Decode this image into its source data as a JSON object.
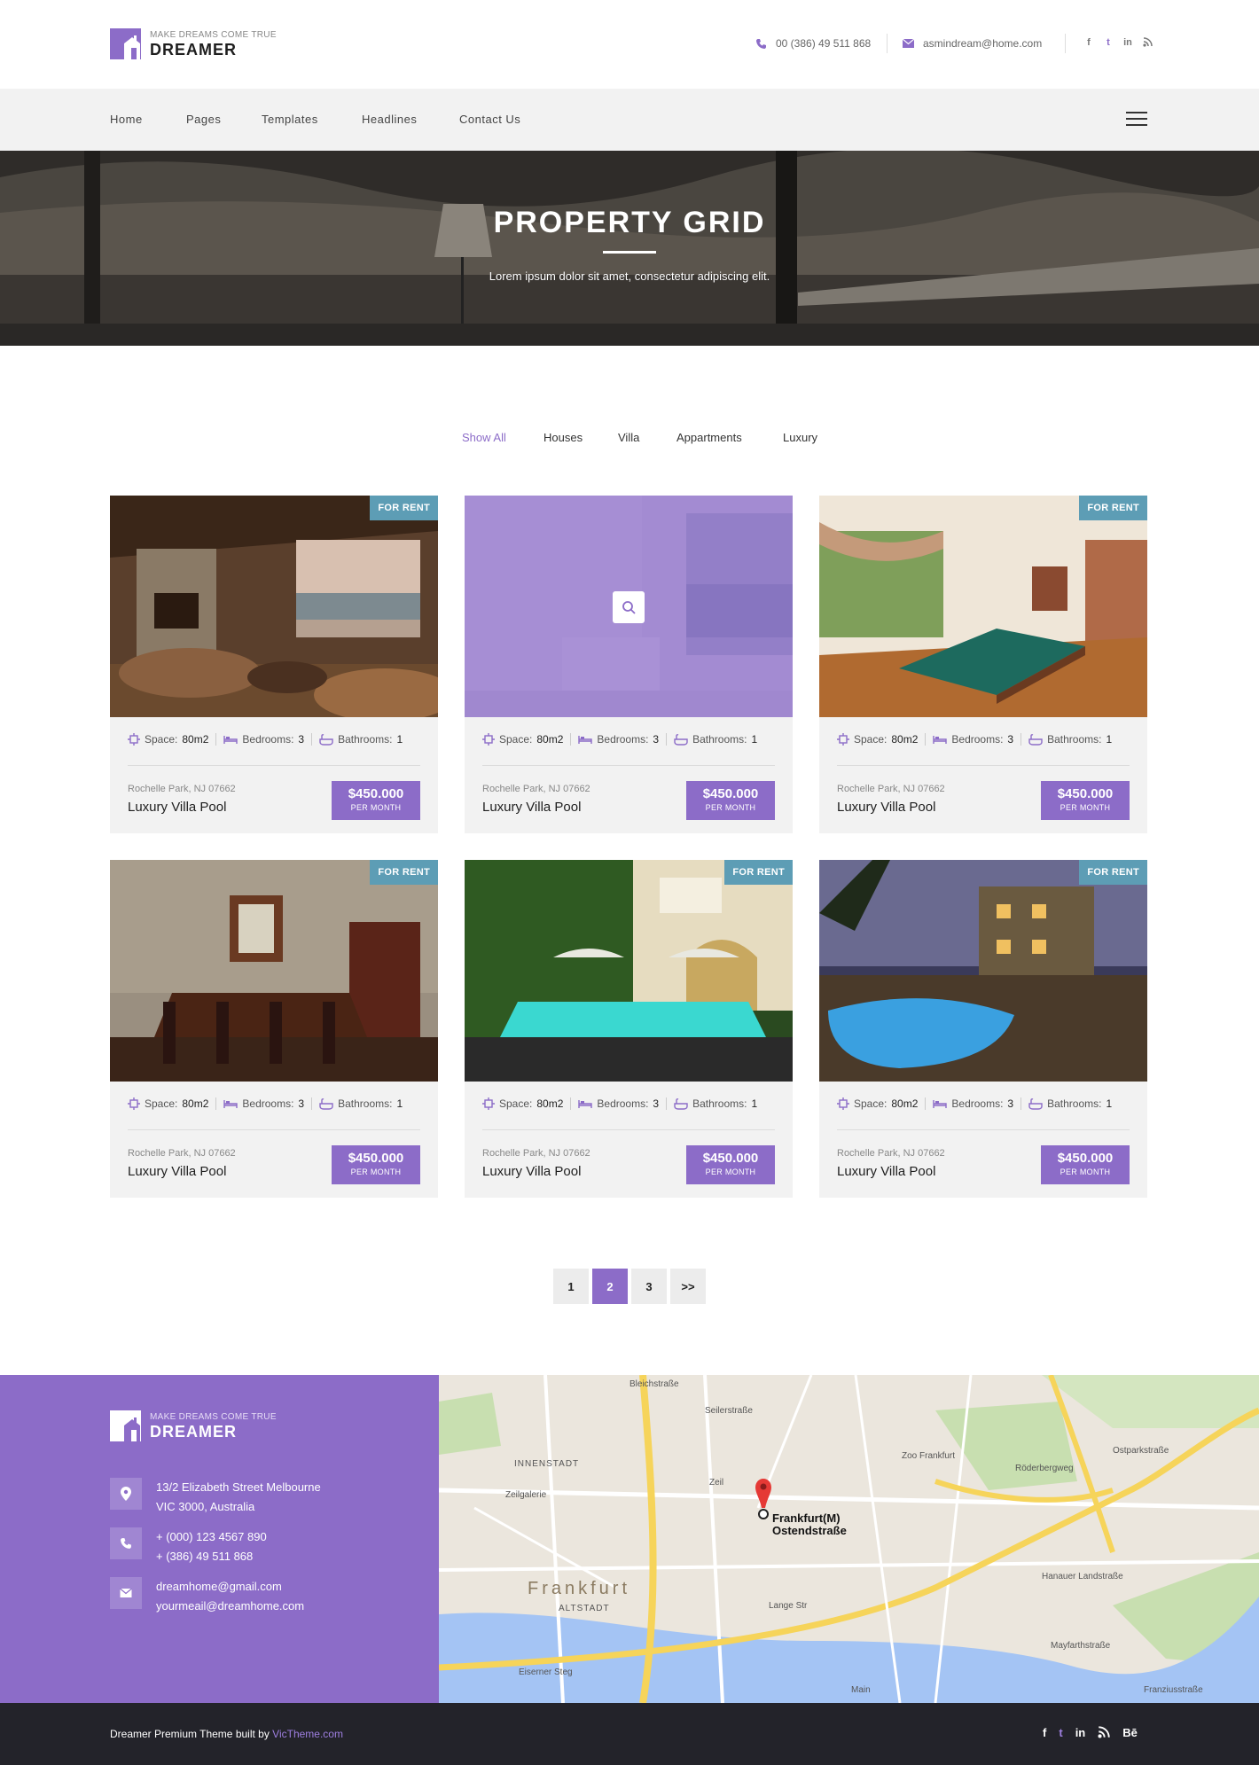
{
  "header": {
    "logo_tagline": "MAKE DREAMS COME TRUE",
    "logo_name": "DREAMER",
    "phone": "00 (386) 49 511 868",
    "email": "asmindream@home.com",
    "social": [
      "f",
      "t",
      "in",
      "rss"
    ]
  },
  "nav": {
    "items": [
      "Home",
      "Pages",
      "Templates",
      "Headlines",
      "Contact Us"
    ]
  },
  "hero": {
    "title": "PROPERTY GRID",
    "subtitle": "Lorem ipsum dolor sit amet, consectetur adipiscing elit."
  },
  "filters": [
    "Show All",
    "Houses",
    "Villa",
    "Appartments",
    "Luxury"
  ],
  "cards": [
    {
      "badge": "FOR RENT",
      "space_label": "Space:",
      "space": "80m2",
      "bedrooms_label": "Bedrooms:",
      "bedrooms": "3",
      "bathrooms_label": "Bathrooms:",
      "bathrooms": "1",
      "address": "Rochelle Park, NJ 07662",
      "title": "Luxury Villa Pool",
      "price": "$450.000",
      "per": "PER MONTH"
    },
    {
      "badge": "",
      "space_label": "Space:",
      "space": "80m2",
      "bedrooms_label": "Bedrooms:",
      "bedrooms": "3",
      "bathrooms_label": "Bathrooms:",
      "bathrooms": "1",
      "address": "Rochelle Park, NJ 07662",
      "title": "Luxury Villa Pool",
      "price": "$450.000",
      "per": "PER MONTH"
    },
    {
      "badge": "FOR RENT",
      "space_label": "Space:",
      "space": "80m2",
      "bedrooms_label": "Bedrooms:",
      "bedrooms": "3",
      "bathrooms_label": "Bathrooms:",
      "bathrooms": "1",
      "address": "Rochelle Park, NJ 07662",
      "title": "Luxury Villa Pool",
      "price": "$450.000",
      "per": "PER MONTH"
    },
    {
      "badge": "FOR RENT",
      "space_label": "Space:",
      "space": "80m2",
      "bedrooms_label": "Bedrooms:",
      "bedrooms": "3",
      "bathrooms_label": "Bathrooms:",
      "bathrooms": "1",
      "address": "Rochelle Park, NJ 07662",
      "title": "Luxury Villa Pool",
      "price": "$450.000",
      "per": "PER MONTH"
    },
    {
      "badge": "FOR RENT",
      "space_label": "Space:",
      "space": "80m2",
      "bedrooms_label": "Bedrooms:",
      "bedrooms": "3",
      "bathrooms_label": "Bathrooms:",
      "bathrooms": "1",
      "address": "Rochelle Park, NJ 07662",
      "title": "Luxury Villa Pool",
      "price": "$450.000",
      "per": "PER MONTH"
    },
    {
      "badge": "FOR RENT",
      "space_label": "Space:",
      "space": "80m2",
      "bedrooms_label": "Bedrooms:",
      "bedrooms": "3",
      "bathrooms_label": "Bathrooms:",
      "bathrooms": "1",
      "address": "Rochelle Park, NJ 07662",
      "title": "Luxury Villa Pool",
      "price": "$450.000",
      "per": "PER MONTH"
    }
  ],
  "pagination": {
    "pages": [
      "1",
      "2",
      "3",
      ">>"
    ],
    "current": "2"
  },
  "footer": {
    "logo_tagline": "MAKE DREAMS COME TRUE",
    "logo_name": "DREAMER",
    "address_line1": "13/2 Elizabeth Street Melbourne",
    "address_line2": "VIC 3000, Australia",
    "phone1": "+ (000) 123 4567 890",
    "phone2": "+ (386) 49 511 868",
    "email1": "dreamhome@gmail.com",
    "email2": "yourmeail@dreamhome.com",
    "credit_text": "Dreamer Premium Theme built by ",
    "credit_link": "VicTheme.com",
    "social": [
      "f",
      "t",
      "in",
      "rss",
      "Bē"
    ]
  },
  "map": {
    "labels": [
      "Bleichstraße",
      "Seilerstraße",
      "INNENSTADT",
      "Zeil",
      "Zeilgalerie",
      "Zoo Frankfurt",
      "Röderbergweg",
      "Ostparkstraße",
      "Frankfurt(M) Ostendstraße",
      "Hanauer Landstraße",
      "Frankfurt",
      "ALTSTADT",
      "Lange Str",
      "Eiserner Steg",
      "Main",
      "Mayfarthstraße",
      "Franziusstraße"
    ]
  },
  "colors": {
    "accent": "#8c6cc8",
    "badge": "#5d9db5",
    "dark": "#23232a",
    "light_bg": "#f2f2f2"
  }
}
